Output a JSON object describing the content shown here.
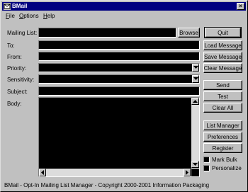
{
  "window": {
    "title": "BMail",
    "close_glyph": "×"
  },
  "menu": [
    {
      "label": "File",
      "accel": "F",
      "rest": "ile"
    },
    {
      "label": "Options",
      "accel": "O",
      "rest": "ptions"
    },
    {
      "label": "Help",
      "accel": "H",
      "rest": "elp"
    }
  ],
  "form": {
    "mailing_list_label": "Mailing List:",
    "browse_label": "Browse",
    "to_label": "To:",
    "from_label": "From:",
    "priority_label": "Priority:",
    "sensitivity_label": "Sensitivity:",
    "subject_label": "Subject:",
    "body_label": "Body:"
  },
  "buttons": {
    "quit": "Quit",
    "load_message": "Load Message",
    "save_message": "Save Message",
    "clear_message": "Clear Message",
    "send": "Send",
    "test": "Test",
    "clear_all": "Clear All",
    "list_manager": "List Manager",
    "preferences": "Preferences",
    "register": "Register"
  },
  "checkboxes": {
    "mark_bulk": "Mark Bulk",
    "personalize": "Personalize"
  },
  "status_text": "BMail - Opt-In Mailing List Manager - Copyright 2000-2001 Information Packaging",
  "colors": {
    "titlebar": "#000080",
    "face": "#c0c0c0",
    "field": "#000000"
  },
  "icons": [
    "app-icon",
    "close-icon",
    "dropdown-arrow-icon",
    "scroll-up-icon",
    "scroll-down-icon",
    "scroll-left-icon",
    "scroll-right-icon"
  ]
}
